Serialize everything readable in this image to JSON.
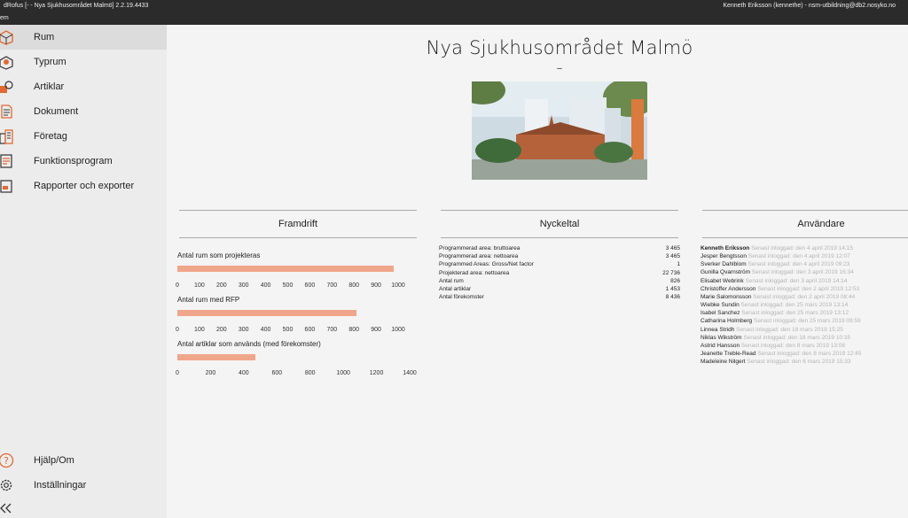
{
  "window": {
    "title": "dRofus [- - Nya Sjukhusområdet Malmö] 2.2.19.4433",
    "user_info": "Kenneth Eriksson (kennethe) - nsm-utbildning@db2.nosyko.no"
  },
  "menu": {
    "label": "em"
  },
  "sidebar": {
    "items": [
      {
        "label": "Rum",
        "icon": "rooms-icon"
      },
      {
        "label": "Typrum",
        "icon": "room-types-icon"
      },
      {
        "label": "Artiklar",
        "icon": "items-icon"
      },
      {
        "label": "Dokument",
        "icon": "documents-icon"
      },
      {
        "label": "Företag",
        "icon": "companies-icon"
      },
      {
        "label": "Funktionsprogram",
        "icon": "function-program-icon"
      },
      {
        "label": "Rapporter och exporter",
        "icon": "reports-icon"
      }
    ],
    "bottom": [
      {
        "label": "Hjälp/Om",
        "icon": "help-icon"
      },
      {
        "label": "Inställningar",
        "icon": "settings-icon"
      }
    ],
    "collapse_icon": "collapse-icon",
    "accent": "#e06a35"
  },
  "project": {
    "title": "Nya Sjukhusområdet Malmö",
    "subtitle": "–"
  },
  "sections": {
    "progress": "Framdrift",
    "key_figures": "Nyckeltal",
    "users": "Användare"
  },
  "chart_data": [
    {
      "type": "bar",
      "title": "Antal rum som projekteras",
      "values": [
        980
      ],
      "xlim": [
        0,
        1000
      ],
      "ticks": [
        "0",
        "100",
        "200",
        "300",
        "400",
        "500",
        "600",
        "700",
        "800",
        "900",
        "1000"
      ],
      "color": "#f0a68a"
    },
    {
      "type": "bar",
      "title": "Antal rum med RFP",
      "values": [
        810
      ],
      "xlim": [
        0,
        1000
      ],
      "ticks": [
        "0",
        "100",
        "200",
        "300",
        "400",
        "500",
        "600",
        "700",
        "800",
        "900",
        "1000"
      ],
      "color": "#f0a68a"
    },
    {
      "type": "bar",
      "title": "Antal artiklar som används (med förekomster)",
      "values": [
        470
      ],
      "xlim": [
        0,
        1400
      ],
      "ticks": [
        "0",
        "200",
        "400",
        "600",
        "800",
        "1000",
        "1200",
        "1400"
      ],
      "color": "#f0a68a"
    }
  ],
  "key_figures": [
    {
      "label": "Programmerad area: bruttoarea",
      "value": "3 465"
    },
    {
      "label": "Programmerad area: nettoarea",
      "value": "3 465"
    },
    {
      "label": "Programmed Areas: Gross/Net factor",
      "value": "1"
    },
    {
      "label": "Projekterad area: nettoarea",
      "value": "22 736"
    },
    {
      "label": "Antal rum",
      "value": "826"
    },
    {
      "label": "Antal artiklar",
      "value": "1 453"
    },
    {
      "label": "Antal förekomster",
      "value": "8 436"
    }
  ],
  "users": [
    {
      "name": "Kenneth Eriksson",
      "status": "Senast inloggad: den 4 april 2019 14:15"
    },
    {
      "name": "Jesper Bengtsson",
      "status": "Senast inloggad: den 4 april 2019 12:07"
    },
    {
      "name": "Sverker Dahlblom",
      "status": "Senast inloggad: den 4 april 2019 09:23"
    },
    {
      "name": "Gunilla Qvarnström",
      "status": "Senast inloggad: den 3 april 2019 16:34"
    },
    {
      "name": "Elisabet Webrink",
      "status": "Senast inloggad: den 3 april 2019 14:14"
    },
    {
      "name": "Christoffer Andersson",
      "status": "Senast inloggad: den 2 april 2019 12:53"
    },
    {
      "name": "Marie Salomonsson",
      "status": "Senast inloggad: den 2 april 2019 08:44"
    },
    {
      "name": "Wiebke Sundin",
      "status": "Senast inloggad: den 25 mars 2019 13:14"
    },
    {
      "name": "Isabel Sanchez",
      "status": "Senast inloggad: den 25 mars 2019 13:12"
    },
    {
      "name": "Catharina Holmberg",
      "status": "Senast inloggad: den 25 mars 2019 09:59"
    },
    {
      "name": "Linnea Stridh",
      "status": "Senast inloggad: den 18 mars 2019 15:25"
    },
    {
      "name": "Niklas Wikström",
      "status": "Senast inloggad: den 18 mars 2019 10:35"
    },
    {
      "name": "Astrid Hansson",
      "status": "Senast inloggad: den 8 mars 2019 13:08"
    },
    {
      "name": "Jeanette Treble-Read",
      "status": "Senast inloggad: den 8 mars 2019 12:45"
    },
    {
      "name": "Madeleine Nilgert",
      "status": "Senast inloggad: den 6 mars 2019 15:33"
    }
  ]
}
